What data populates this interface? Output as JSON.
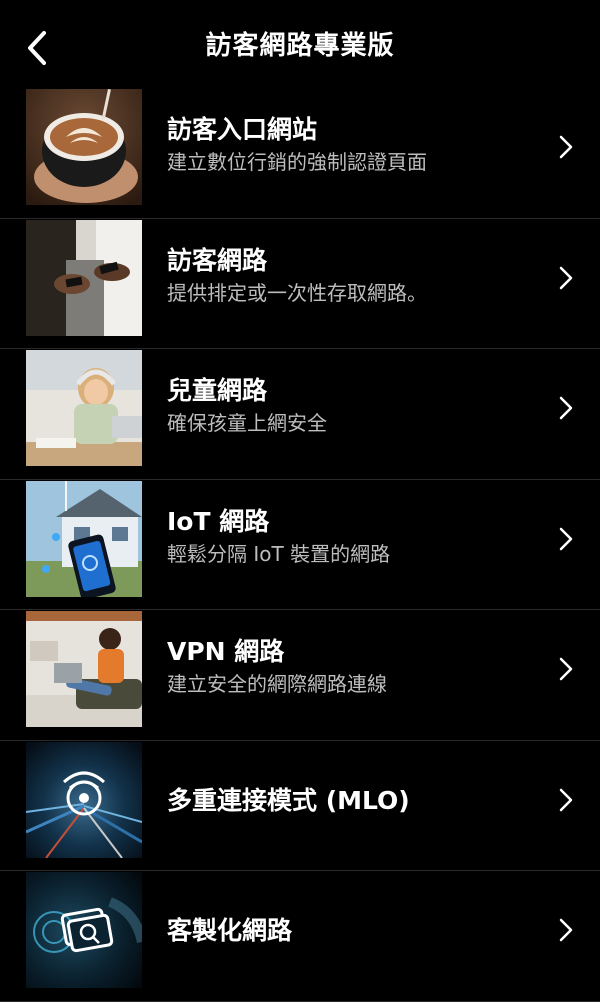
{
  "header": {
    "title": "訪客網路專業版",
    "back_icon": "chevron-left-icon"
  },
  "items": [
    {
      "title": "訪客入口網站",
      "subtitle": "建立數位行銷的強制認證頁面",
      "image": "latte-art-photo"
    },
    {
      "title": "訪客網路",
      "subtitle": "提供排定或一次性存取網路。",
      "image": "people-phones-photo"
    },
    {
      "title": "兒童網路",
      "subtitle": "確保孩童上網安全",
      "image": "child-studying-photo"
    },
    {
      "title": "IoT 網路",
      "subtitle": "輕鬆分隔 IoT 裝置的網路",
      "image": "smart-home-photo"
    },
    {
      "title": "VPN 網路",
      "subtitle": "建立安全的網際網路連線",
      "image": "woman-laptop-photo"
    },
    {
      "title": "多重連接模式 (MLO)",
      "subtitle": "",
      "image": "mlo-wifi-graphic"
    },
    {
      "title": "客製化網路",
      "subtitle": "",
      "image": "custom-network-graphic"
    }
  ],
  "colors": {
    "background": "#000000",
    "text": "#ffffff",
    "subtitle": "#bdbdbd",
    "divider": "#2a2a2a"
  }
}
